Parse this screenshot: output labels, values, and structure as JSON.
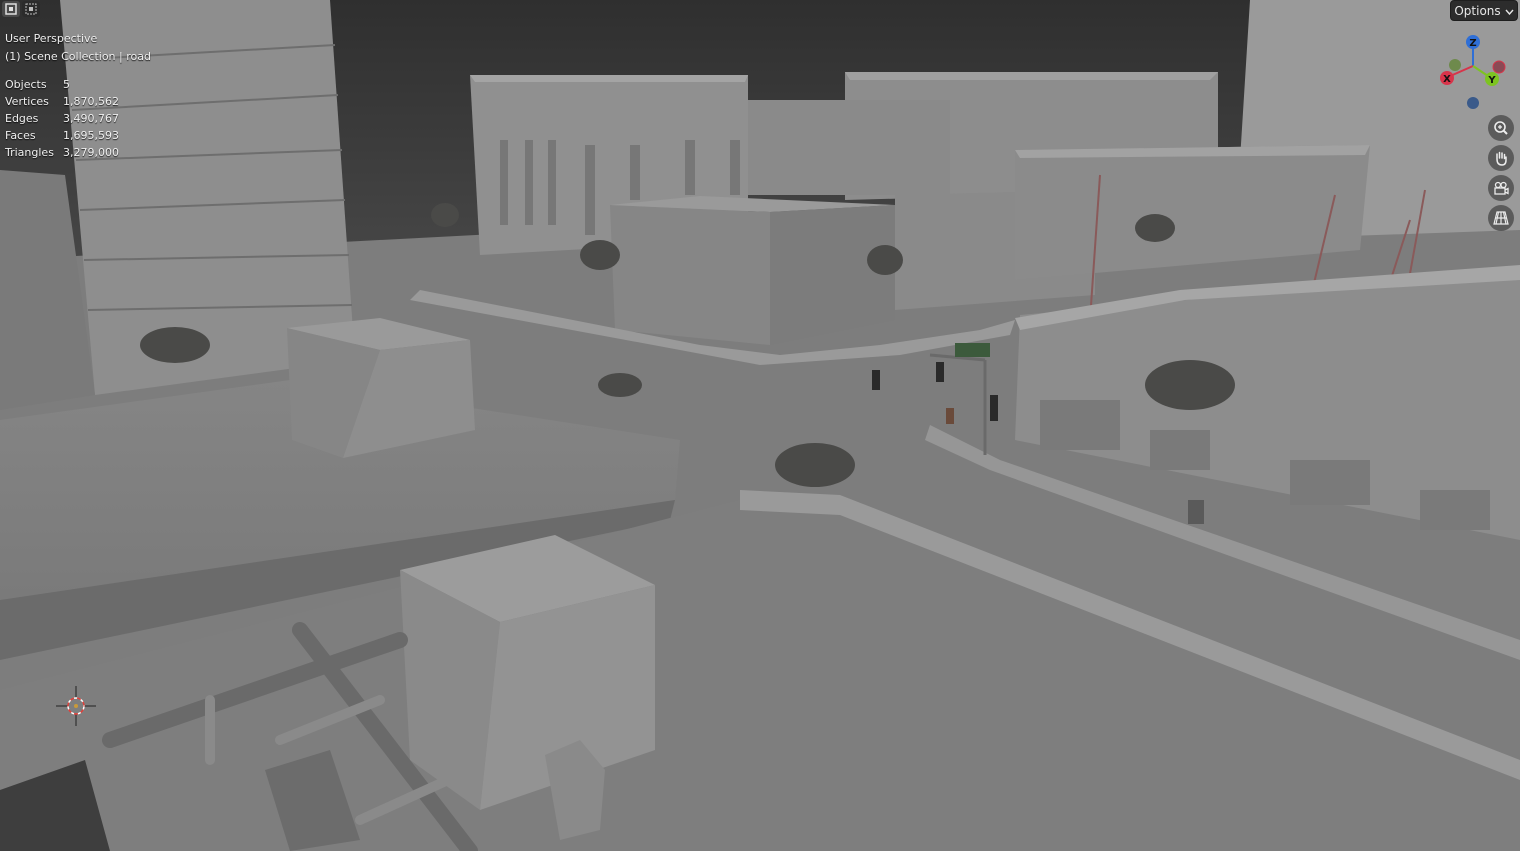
{
  "viewport": {
    "view_name": "User Perspective",
    "collection_path": "(1) Scene Collection | road"
  },
  "stats": [
    {
      "label": "Objects",
      "value": "5"
    },
    {
      "label": "Vertices",
      "value": "1,870,562"
    },
    {
      "label": "Edges",
      "value": "3,490,767"
    },
    {
      "label": "Faces",
      "value": "1,695,593"
    },
    {
      "label": "Triangles",
      "value": "3,279,000"
    }
  ],
  "header": {
    "options_label": "Options",
    "mode_icons": [
      "select-box-icon",
      "select-mode-icon"
    ]
  },
  "gizmo": {
    "axes": [
      {
        "label": "Z",
        "color": "#2f6fd6"
      },
      {
        "label": "X",
        "color": "#d8344a"
      },
      {
        "label": "Y",
        "color": "#7dc421"
      }
    ]
  },
  "nav_buttons": [
    "zoom-icon",
    "hand-pan-icon",
    "camera-icon",
    "grid-perspective-icon"
  ],
  "colors": {
    "sky": "#3a3a3a",
    "ground": "#7c7c7c",
    "building": "#8c8c8c",
    "building_shadow": "#6f6f6f",
    "text": "#f0f0f0"
  }
}
